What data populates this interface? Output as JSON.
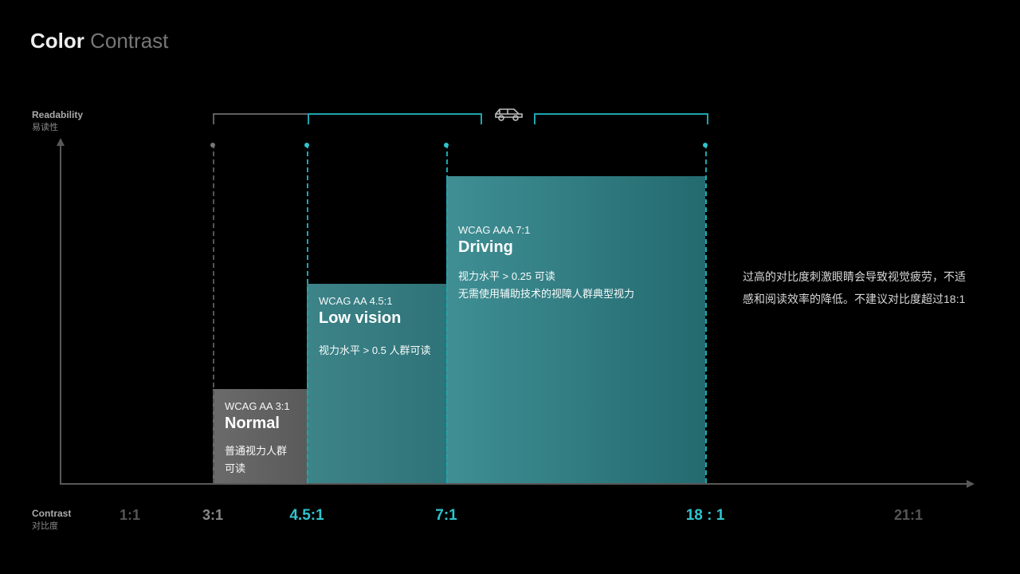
{
  "title_bold": "Color",
  "title_light": " Contrast",
  "axes": {
    "y_en": "Readability",
    "y_cn": "易读性",
    "x_en": "Contrast",
    "x_cn": "对比度"
  },
  "ticks": {
    "t1": "1:1",
    "t3": "3:1",
    "t4_5": "4.5:1",
    "t7": "7:1",
    "t18": "18 : 1",
    "t21": "21:1"
  },
  "bars": {
    "normal": {
      "hdr": "WCAG AA   3:1",
      "title": "Normal",
      "desc": "普通视力人群可读"
    },
    "low": {
      "hdr": "WCAG AA   4.5:1",
      "title": "Low vision",
      "desc": "视力水平 > 0.5 人群可读"
    },
    "drive": {
      "hdr": "WCAG AAA   7:1",
      "title": "Driving",
      "desc1": "视力水平 > 0.25 可读",
      "desc2": "无需使用辅助技术的视障人群典型视力"
    }
  },
  "note": "过高的对比度刺激眼睛会导致视觉疲劳，不适感和阅读效率的降低。不建议对比度超过18:1",
  "chart_data": {
    "type": "bar",
    "x_axis": "contrast ratio",
    "y_axis": "readability",
    "ranges": [
      {
        "name": "Normal",
        "wcag": "AA 3:1",
        "range": [
          3,
          4.5
        ],
        "note": "普通视力人群可读"
      },
      {
        "name": "Low vision",
        "wcag": "AA 4.5:1",
        "range": [
          4.5,
          7
        ],
        "note": "视力水平 > 0.5 人群可读"
      },
      {
        "name": "Driving",
        "wcag": "AAA 7:1",
        "range": [
          7,
          18
        ],
        "note": "视力水平 > 0.25 可读；无需使用辅助技术的视障人群典型视力"
      }
    ],
    "ticks": [
      1,
      3,
      4.5,
      7,
      18,
      21
    ],
    "warning": "不建议对比度超过 18:1"
  }
}
